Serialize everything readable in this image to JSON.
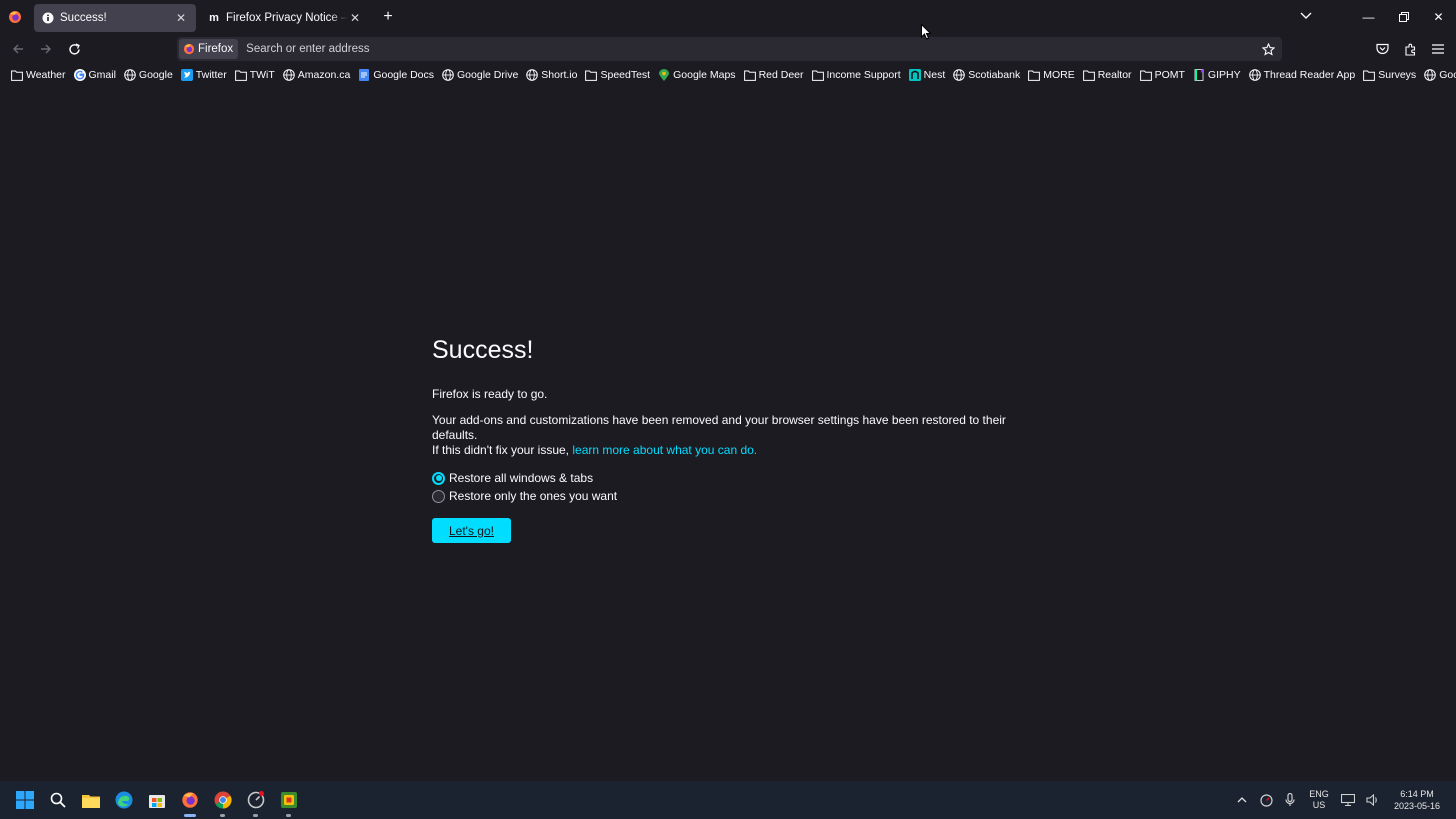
{
  "window": {
    "tabs": [
      {
        "title": "Success!",
        "active": true,
        "favicon": "info-icon"
      },
      {
        "title": "Firefox Privacy Notice — Mozilla",
        "active": false,
        "favicon": "mozilla-m-icon"
      }
    ]
  },
  "navbar": {
    "identity_label": "Firefox",
    "url_placeholder": "Search or enter address"
  },
  "bookmarks": [
    {
      "label": "Weather",
      "icon": "folder-icon"
    },
    {
      "label": "Gmail",
      "icon": "google-g-icon"
    },
    {
      "label": "Google",
      "icon": "globe-icon"
    },
    {
      "label": "Twitter",
      "icon": "twitter-icon"
    },
    {
      "label": "TWiT",
      "icon": "folder-icon"
    },
    {
      "label": "Amazon.ca",
      "icon": "globe-icon"
    },
    {
      "label": "Google Docs",
      "icon": "docs-icon"
    },
    {
      "label": "Google Drive",
      "icon": "globe-icon"
    },
    {
      "label": "Short.io",
      "icon": "globe-icon"
    },
    {
      "label": "SpeedTest",
      "icon": "folder-icon"
    },
    {
      "label": "Google Maps",
      "icon": "maps-pin-icon"
    },
    {
      "label": "Red Deer",
      "icon": "folder-icon"
    },
    {
      "label": "Income Support",
      "icon": "folder-icon"
    },
    {
      "label": "Nest",
      "icon": "nest-icon"
    },
    {
      "label": "Scotiabank",
      "icon": "globe-icon"
    },
    {
      "label": "MORE",
      "icon": "folder-icon"
    },
    {
      "label": "Realtor",
      "icon": "folder-icon"
    },
    {
      "label": "POMT",
      "icon": "folder-icon"
    },
    {
      "label": "GIPHY",
      "icon": "giphy-icon"
    },
    {
      "label": "Thread Reader App",
      "icon": "globe-icon"
    },
    {
      "label": "Surveys",
      "icon": "folder-icon"
    },
    {
      "label": "Google Translate",
      "icon": "globe-icon"
    }
  ],
  "page": {
    "title": "Success!",
    "ready_text": "Firefox is ready to go.",
    "removed_text": "Your add-ons and customizations have been removed and your browser settings have been restored to their defaults.",
    "fix_text": "If this didn't fix your issue, ",
    "learn_more": "learn more about what you can do.",
    "options": [
      {
        "label": "Restore all windows & tabs",
        "checked": true
      },
      {
        "label": "Restore only the ones you want",
        "checked": false
      }
    ],
    "button_label": "Let's go!"
  },
  "taskbar": {
    "lang_top": "ENG",
    "lang_bottom": "US",
    "time": "6:14 PM",
    "date": "2023-05-16"
  },
  "colors": {
    "accent": "#00ddff",
    "background": "#1c1b22",
    "taskbar": "#1b2330"
  }
}
